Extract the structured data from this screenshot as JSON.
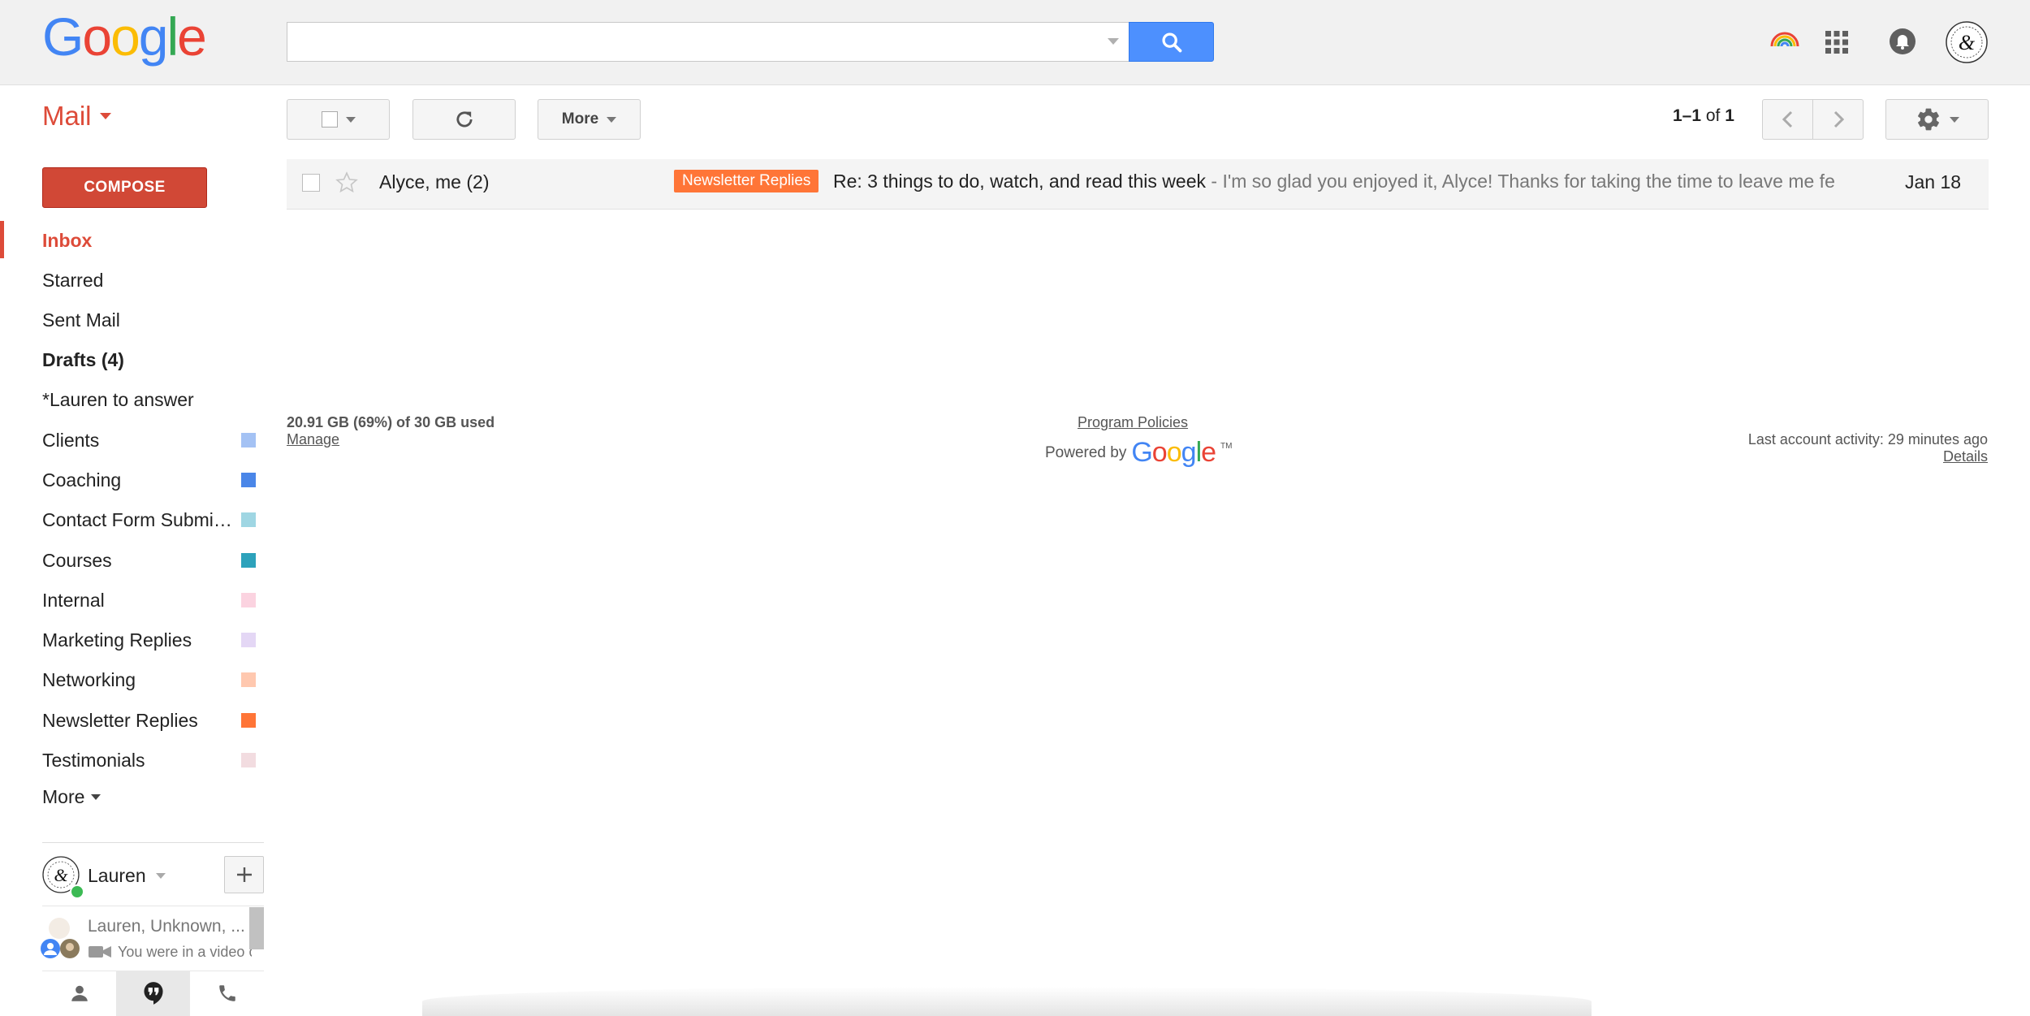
{
  "brand": {
    "logo_letters": [
      "G",
      "o",
      "o",
      "g",
      "l",
      "e"
    ]
  },
  "search": {
    "placeholder": "",
    "value": ""
  },
  "header": {
    "account_name": ""
  },
  "toolbar": {
    "mail_label": "Mail",
    "more_label": "More",
    "pager_range": "1–1",
    "pager_of": " of ",
    "pager_total": "1"
  },
  "sidebar": {
    "compose_label": "COMPOSE",
    "items": [
      {
        "label": "Inbox",
        "active": true
      },
      {
        "label": "Starred"
      },
      {
        "label": "Sent Mail"
      },
      {
        "label": "Drafts (4)",
        "bold": true
      },
      {
        "label": "*Lauren to answer"
      },
      {
        "label": "Clients",
        "color": "#a4c2f4"
      },
      {
        "label": "Coaching",
        "color": "#4a86e8"
      },
      {
        "label": "Contact Form Submissions",
        "color": "#9fd6e3"
      },
      {
        "label": "Courses",
        "color": "#2da2bb"
      },
      {
        "label": "Internal",
        "color": "#fbd3e0"
      },
      {
        "label": "Marketing Replies",
        "color": "#e4d7f5"
      },
      {
        "label": "Networking",
        "color": "#ffc8af"
      },
      {
        "label": "Newsletter Replies",
        "color": "#ff7537"
      },
      {
        "label": "Testimonials",
        "color": "#f2dce0"
      }
    ],
    "more_label": "More"
  },
  "messages": [
    {
      "sender": "Alyce, me (2)",
      "label": "Newsletter Replies",
      "label_color": "#ff7537",
      "subject": "Re: 3 things to do, watch, and read this week",
      "snippet": " - I'm so glad you enjoyed it, Alyce! Thanks for taking the time to leave me feedback",
      "date": "Jan 18"
    }
  ],
  "footer": {
    "storage": "20.91 GB (69%) of 30 GB used",
    "manage": "Manage",
    "policies": "Program Policies",
    "powered_by": "Powered by",
    "google_word": [
      "G",
      "o",
      "o",
      "g",
      "l",
      "e"
    ],
    "tm": "TM",
    "activity": "Last account activity: 29 minutes ago",
    "details": "Details"
  },
  "hangouts": {
    "user_name": "Lauren",
    "conversation_title": "Lauren, Unknown, ...",
    "conversation_sub": "You were in a video call"
  },
  "colors": {
    "accent_red": "#dd4b39",
    "search_blue": "#4d90fe",
    "compose_red": "#d14836",
    "online_green": "#3cba54"
  },
  "icons": [
    "search-icon",
    "caret-down-icon",
    "hangouts-rainbow-icon",
    "apps-grid-icon",
    "notifications-bell-icon",
    "account-avatar-icon",
    "refresh-icon",
    "chevron-left-icon",
    "chevron-right-icon",
    "gear-icon",
    "star-icon",
    "plus-icon",
    "person-icon",
    "hangouts-quote-icon",
    "phone-icon",
    "video-camera-icon"
  ]
}
